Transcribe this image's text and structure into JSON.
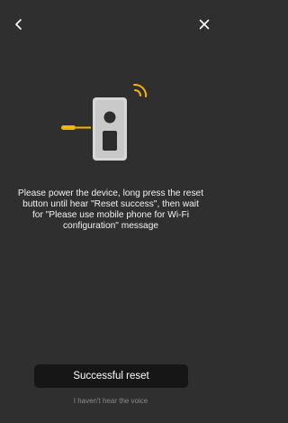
{
  "header": {
    "back_icon": "chevron-left-icon",
    "close_icon": "close-icon"
  },
  "illustration": {
    "device_icon": "doorbell-device-icon",
    "tool_icon": "reset-pin-icon",
    "signal_icon": "sound-wave-icon",
    "accent_color": "#f2b500"
  },
  "main": {
    "instruction": "Please power the device, long press the reset button until hear \"Reset success\", then wait for \"Please use mobile phone for Wi-Fi configuration\" message"
  },
  "actions": {
    "primary_label": "Successful reset",
    "secondary_label": "I haven't hear the voice"
  }
}
